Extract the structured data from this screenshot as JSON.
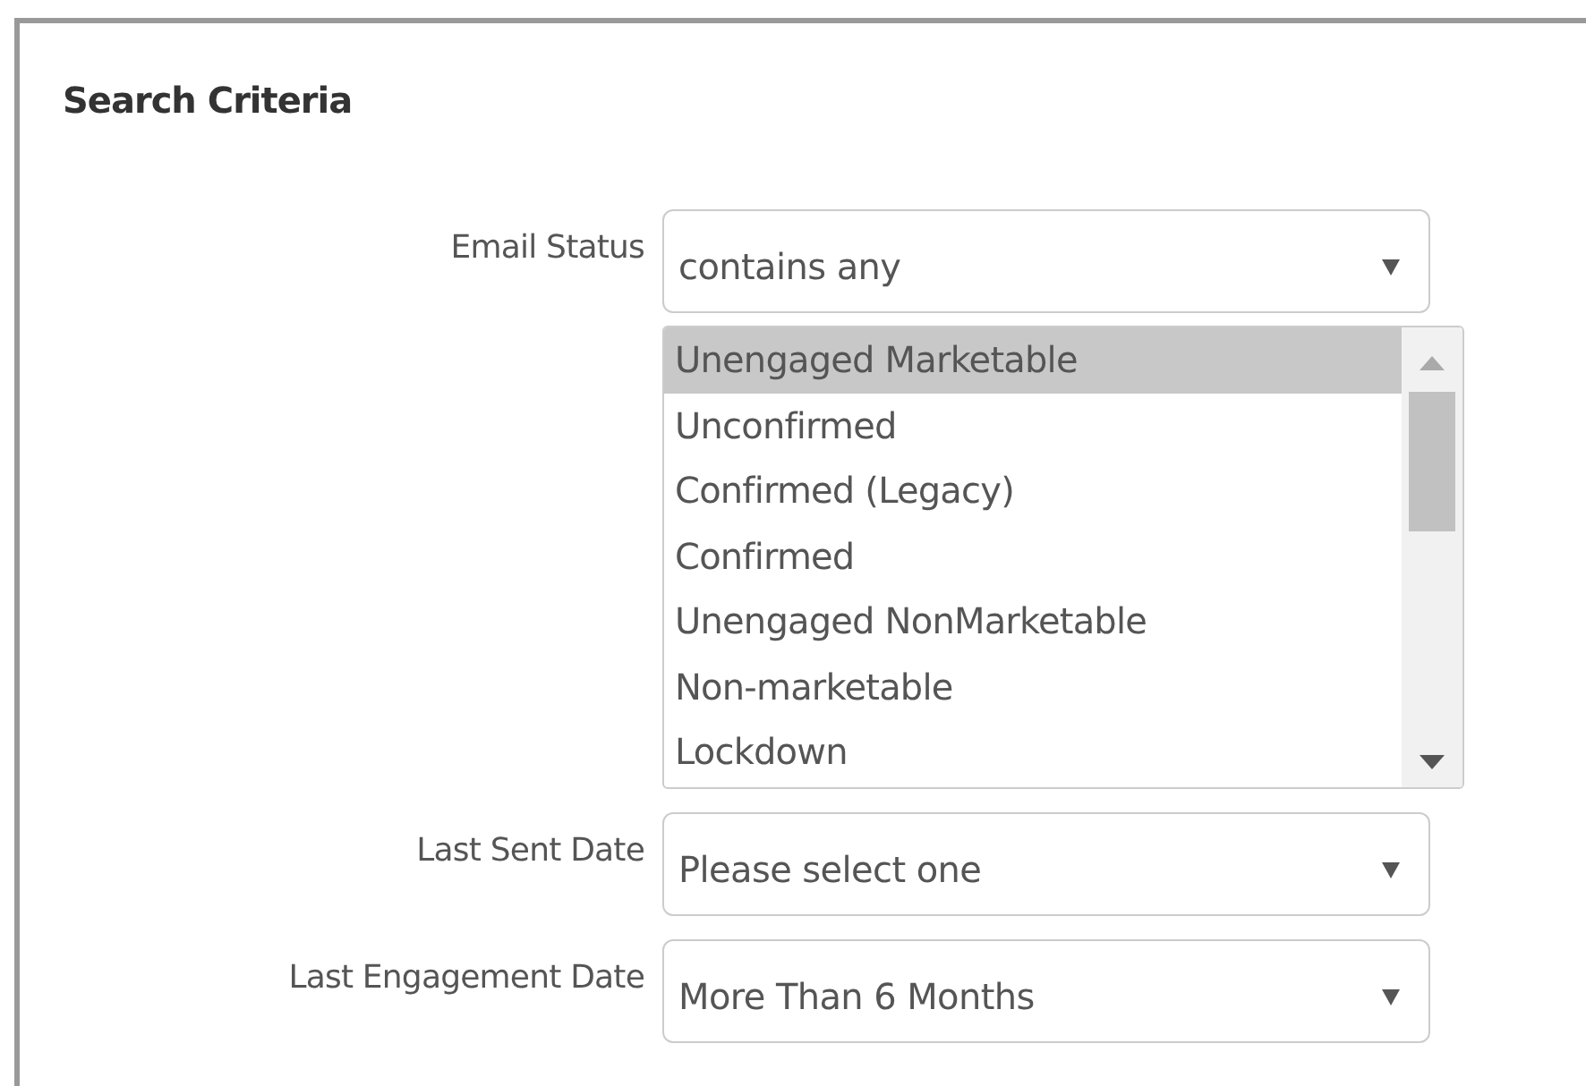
{
  "title": "Search Criteria",
  "fields": [
    {
      "label": "Email Status",
      "kind": "select",
      "value": "contains any",
      "options": [
        {
          "label": "Unengaged Marketable",
          "selected": true
        },
        {
          "label": "Unconfirmed",
          "selected": false
        },
        {
          "label": "Confirmed (Legacy)",
          "selected": false
        },
        {
          "label": "Confirmed",
          "selected": false
        },
        {
          "label": "Unengaged NonMarketable",
          "selected": false
        },
        {
          "label": "Non-marketable",
          "selected": false
        },
        {
          "label": "Lockdown",
          "selected": false
        }
      ]
    },
    {
      "label": "Last Sent Date",
      "kind": "select",
      "value": "Please select one"
    },
    {
      "label": "Last Engagement Date",
      "kind": "select",
      "value": "More Than 6 Months"
    }
  ]
}
